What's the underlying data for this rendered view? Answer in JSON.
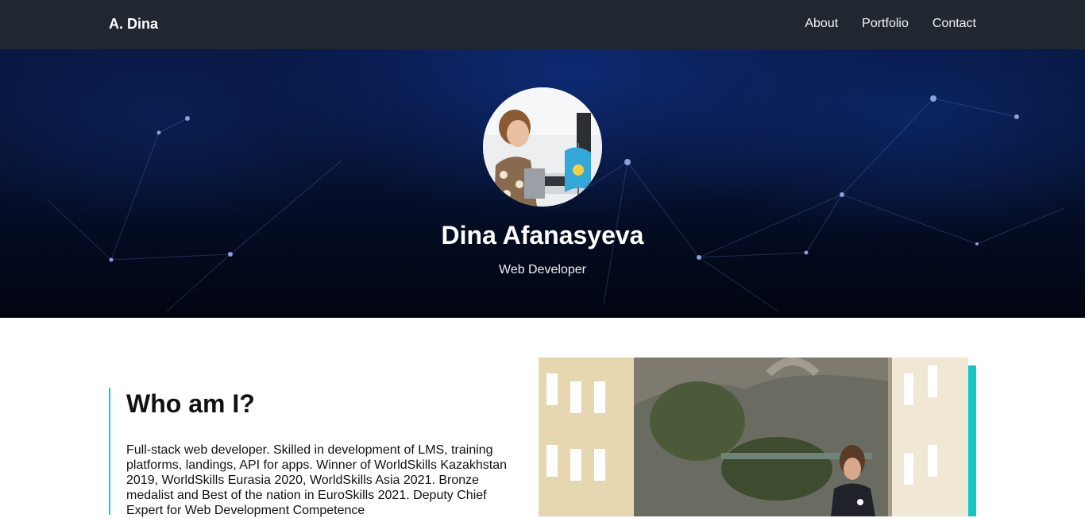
{
  "navbar": {
    "brand": "A. Dina",
    "links": [
      "About",
      "Portfolio",
      "Contact"
    ]
  },
  "hero": {
    "name": "Dina Afanasyeva",
    "role": "Web Developer"
  },
  "about": {
    "title": "Who am I?",
    "text": "Full-stack web developer. Skilled in development of LMS, training platforms, landings, API for apps. Winner of WorldSkills Kazakhstan 2019, WorldSkills Eurasia 2020, WorldSkills Asia 2021. Bronze medalist and Best of the nation in EuroSkills 2021. Deputy Chief Expert for Web Development Competence"
  },
  "colors": {
    "navbar_bg": "#212731",
    "accent": "#15c4c4",
    "hero_dark": "#020510",
    "hero_blue": "#0d2a72"
  },
  "icons": {
    "hero_background": "network-constellation-image",
    "avatar": "profile-photo",
    "about_photo": "city-photo"
  }
}
